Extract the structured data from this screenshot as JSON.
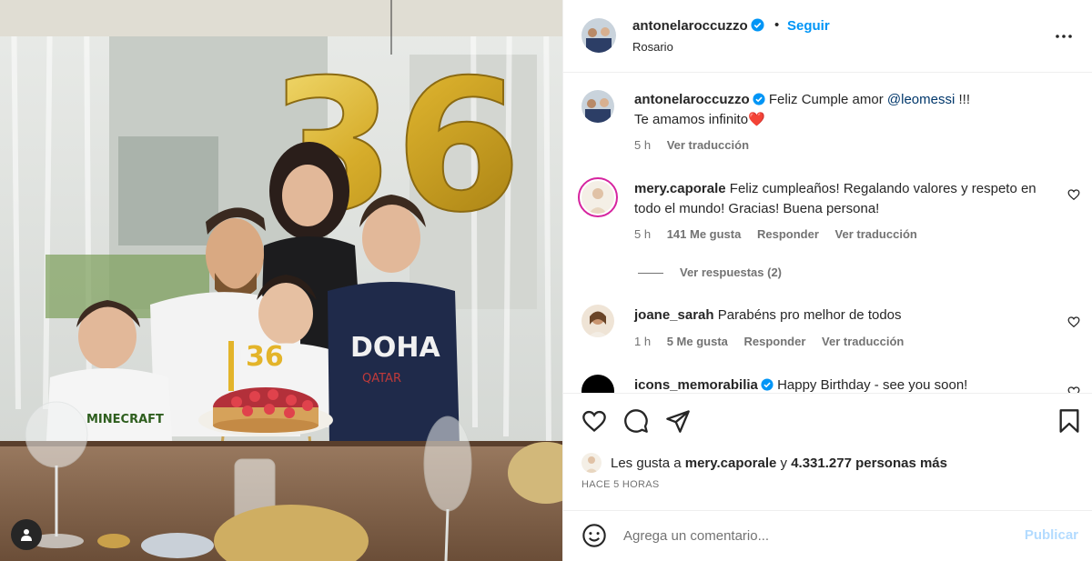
{
  "post": {
    "username": "antonelaroccuzzo",
    "separator": "•",
    "follow_label": "Seguir",
    "location": "Rosario",
    "balloon_text": "36",
    "cake_topper": "36",
    "shirt_text": "DOHA",
    "shirt_subtext": "QATAR",
    "kid_shirt_text": "MINECRAFT"
  },
  "caption": {
    "username": "antonelaroccuzzo",
    "text": "Feliz Cumple amor",
    "mention": "@leomessi",
    "text_end": "!!!",
    "line2": "Te amamos infinito",
    "emoji": "❤️",
    "time": "5 h",
    "translate": "Ver traducción"
  },
  "comments": [
    {
      "username": "mery.caporale",
      "text": "Feliz cumpleaños! Regalando valores y respeto en todo el mundo! Gracias! Buena persona!",
      "time": "5 h",
      "likes": "141 Me gusta",
      "reply": "Responder",
      "translate": "Ver traducción",
      "view_replies": "Ver respuestas (2)"
    },
    {
      "username": "joane_sarah",
      "text": "Parabéns pro melhor de todos",
      "time": "1 h",
      "likes": "5 Me gusta",
      "reply": "Responder",
      "translate": "Ver traducción"
    },
    {
      "username": "icons_memorabilia",
      "text": "Happy Birthday - see you soon!"
    }
  ],
  "likes_summary": {
    "prefix": "Les gusta a",
    "user": "mery.caporale",
    "joiner": "y",
    "count": "4.331.277 personas más"
  },
  "timestamp": "HACE 5 HORAS",
  "comment_input": {
    "placeholder": "Agrega un comentario...",
    "publish_label": "Publicar"
  },
  "icons": [
    "heart-icon",
    "comment-icon",
    "share-icon",
    "bookmark-icon",
    "more-icon",
    "emoji-icon",
    "verified-icon",
    "user-tag-icon"
  ],
  "colors": {
    "accent": "#0095f6",
    "mention": "#00376b",
    "verified": "#0095f6",
    "heart": "#ff3040",
    "publish_disabled": "#b3dbff"
  }
}
